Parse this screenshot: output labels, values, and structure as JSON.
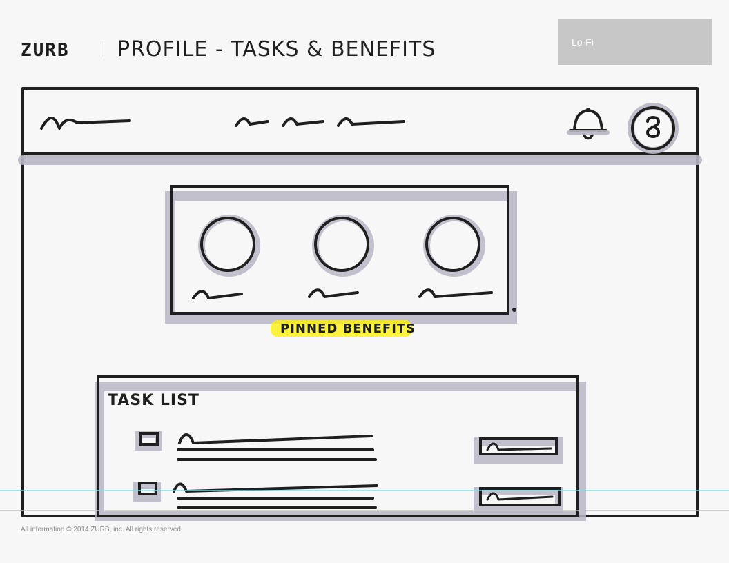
{
  "header": {
    "brand": "ZURB",
    "title": "PROFILE - TASKS & BENEFITS",
    "badge": "Lo-Fi"
  },
  "sketch": {
    "pinned_benefits_label": "PINNED BENEFITS",
    "task_list_title": "TASK LIST"
  },
  "footer": {
    "copyright": "All information © 2014 ZURB, inc.  All rights reserved."
  },
  "icons": {
    "notifications": "bell-icon",
    "profile": "avatar-icon"
  },
  "colors": {
    "paper": "#f7f7f7",
    "ink": "#1f1f1f",
    "shadow": "#b8b6c4",
    "badge_bg": "#c7c7c7",
    "highlight": "#fff200",
    "guide": "#6ee7ee"
  }
}
